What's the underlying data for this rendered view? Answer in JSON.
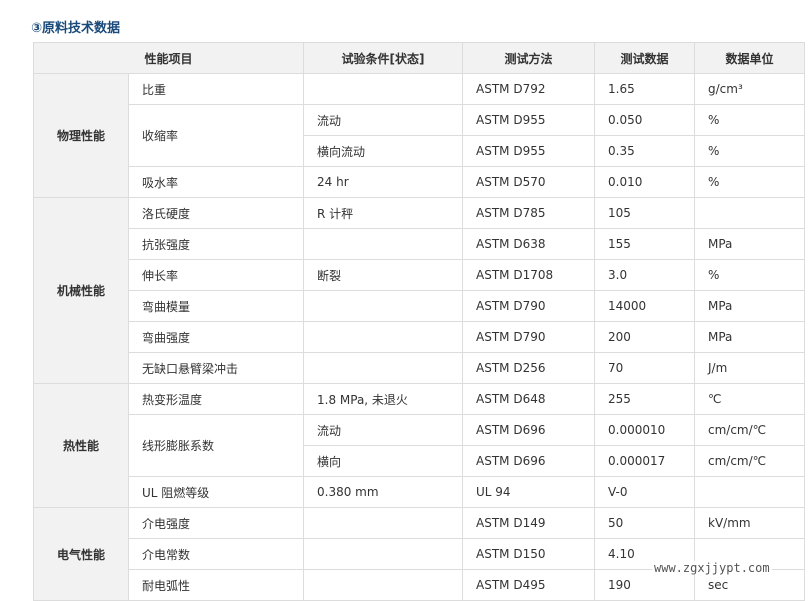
{
  "section_title": "③原料技术数据",
  "headers": [
    "性能项目",
    "试验条件[状态]",
    "测试方法",
    "测试数据",
    "数据单位"
  ],
  "categories": {
    "physical": "物理性能",
    "mechanical": "机械性能",
    "thermal": "热性能",
    "electrical": "电气性能"
  },
  "rows": [
    {
      "item": "比重",
      "cond": "",
      "method": "ASTM D792",
      "value": "1.65",
      "unit": "g/cm³"
    },
    {
      "item": "收缩率",
      "cond": "流动",
      "method": "ASTM D955",
      "value": "0.050",
      "unit": "%"
    },
    {
      "item": "",
      "cond": "横向流动",
      "method": "ASTM D955",
      "value": "0.35",
      "unit": "%"
    },
    {
      "item": "吸水率",
      "cond": "24 hr",
      "method": "ASTM D570",
      "value": "0.010",
      "unit": "%"
    },
    {
      "item": "洛氏硬度",
      "cond": "R 计秤",
      "method": "ASTM D785",
      "value": "105",
      "unit": ""
    },
    {
      "item": "抗张强度",
      "cond": "",
      "method": "ASTM D638",
      "value": "155",
      "unit": "MPa"
    },
    {
      "item": "伸长率",
      "cond": "断裂",
      "method": "ASTM D1708",
      "value": "3.0",
      "unit": "%"
    },
    {
      "item": "弯曲模量",
      "cond": "",
      "method": "ASTM D790",
      "value": "14000",
      "unit": "MPa"
    },
    {
      "item": "弯曲强度",
      "cond": "",
      "method": "ASTM D790",
      "value": "200",
      "unit": "MPa"
    },
    {
      "item": "无缺口悬臂梁冲击",
      "cond": "",
      "method": "ASTM D256",
      "value": "70",
      "unit": "J/m"
    },
    {
      "item": "热变形温度",
      "cond": "1.8 MPa, 未退火",
      "method": "ASTM D648",
      "value": "255",
      "unit": "℃"
    },
    {
      "item": "线形膨胀系数",
      "cond": "流动",
      "method": "ASTM D696",
      "value": "0.000010",
      "unit": "cm/cm/℃"
    },
    {
      "item": "",
      "cond": "横向",
      "method": "ASTM D696",
      "value": "0.000017",
      "unit": "cm/cm/℃"
    },
    {
      "item": "UL 阻燃等级",
      "cond": "0.380 mm",
      "method": "UL 94",
      "value": "V-0",
      "unit": ""
    },
    {
      "item": "介电强度",
      "cond": "",
      "method": "ASTM D149",
      "value": "50",
      "unit": "kV/mm"
    },
    {
      "item": "介电常数",
      "cond": "",
      "method": "ASTM D150",
      "value": "4.10",
      "unit": ""
    },
    {
      "item": "耐电弧性",
      "cond": "",
      "method": "ASTM D495",
      "value": "190",
      "unit": "sec"
    }
  ],
  "watermark": "www.zgxjjypt.com"
}
